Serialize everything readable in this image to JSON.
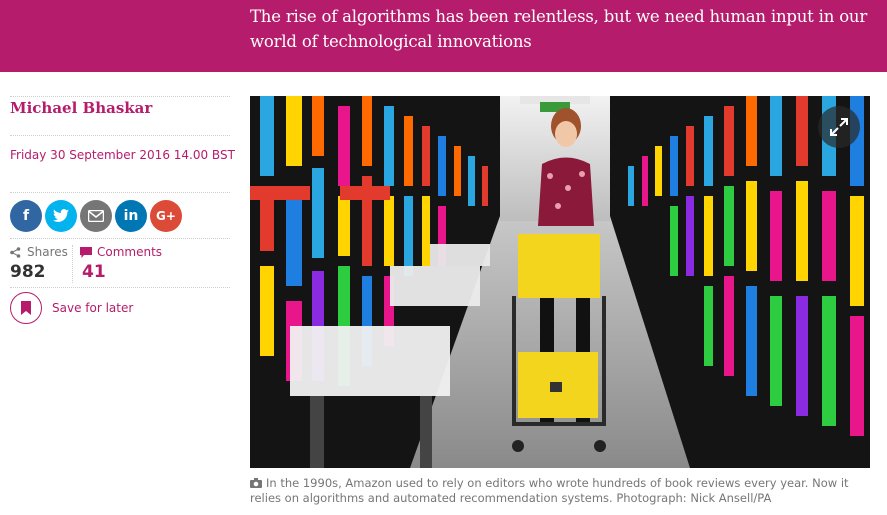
{
  "article": {
    "standfirst": "The rise of algorithms has been relentless, but we need human input in our world of technological innovations",
    "author": "Michael Bhaskar",
    "dateline": "Friday 30 September 2016 14.00 BST"
  },
  "share": {
    "buttons": [
      {
        "icon": "facebook-icon",
        "glyph": "f"
      },
      {
        "icon": "twitter-icon",
        "glyph": "t"
      },
      {
        "icon": "email-icon",
        "glyph": "✉"
      },
      {
        "icon": "linkedin-icon",
        "glyph": "in"
      },
      {
        "icon": "googleplus-icon",
        "glyph": "G+"
      }
    ]
  },
  "stats": {
    "shares_label": "Shares",
    "shares_count": "982",
    "comments_label": "Comments",
    "comments_count": "41"
  },
  "save": {
    "label": "Save for later"
  },
  "media": {
    "caption": "In the 1990s, Amazon used to rely on editors who wrote hundreds of book reviews every year. Now it relies on algorithms and automated recommendation systems. Photograph: Nick Ansell/PA"
  },
  "colors": {
    "brand": "#b51c6b",
    "caption": "#767676"
  }
}
